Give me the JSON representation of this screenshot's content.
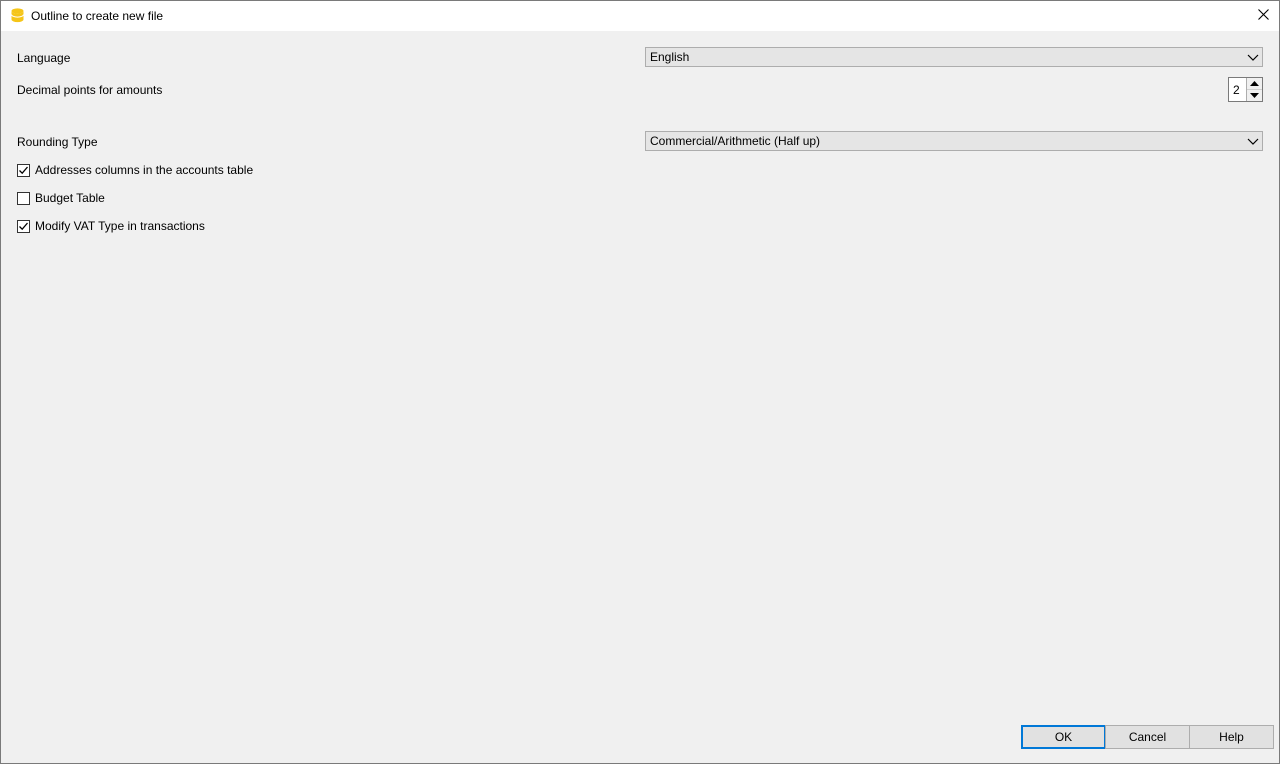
{
  "window": {
    "title": "Outline to create new file",
    "icon": "app-database-icon",
    "close_icon": "close-icon"
  },
  "form": {
    "language": {
      "label": "Language",
      "value": "English"
    },
    "decimal_points": {
      "label": "Decimal points for amounts",
      "value": "2"
    },
    "rounding_type": {
      "label": "Rounding Type",
      "value": "Commercial/Arithmetic (Half up)"
    },
    "options": [
      {
        "label": "Addresses columns in the accounts table",
        "checked": true
      },
      {
        "label": "Budget Table",
        "checked": false
      },
      {
        "label": "Modify VAT Type in transactions",
        "checked": true
      }
    ]
  },
  "buttons": {
    "ok": "OK",
    "cancel": "Cancel",
    "help": "Help"
  },
  "colors": {
    "accent": "#0078d7",
    "icon_yellow": "#f5c518"
  }
}
